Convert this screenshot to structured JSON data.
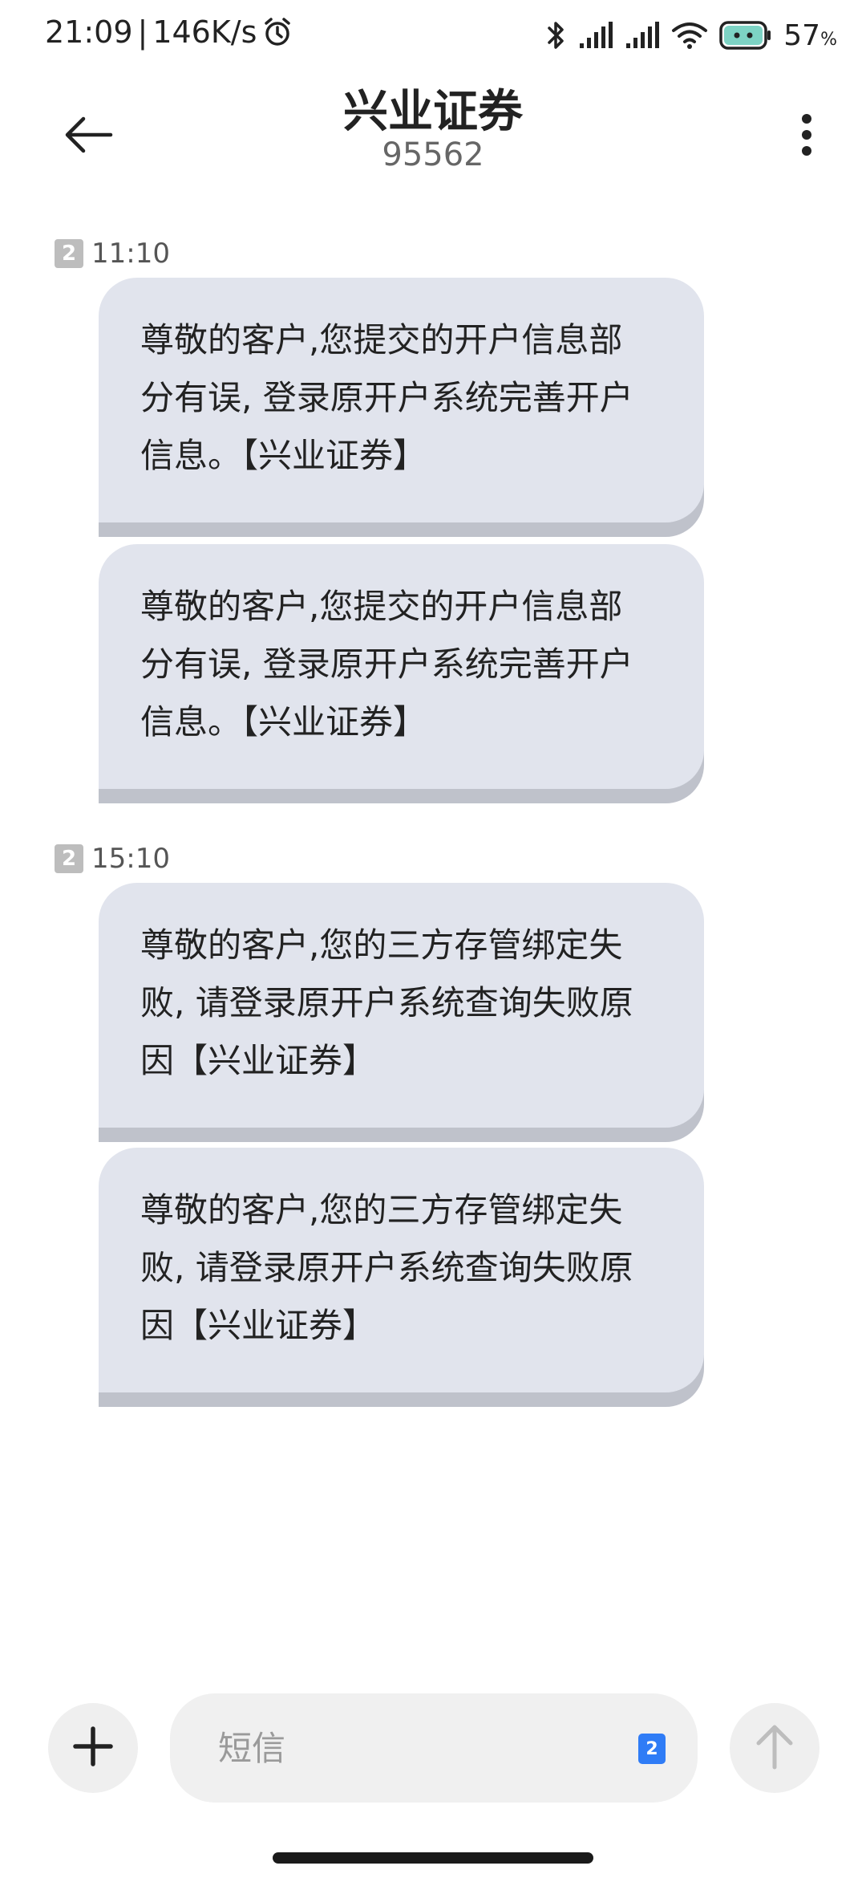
{
  "status_bar": {
    "time": "21:09",
    "separator": "|",
    "network_speed": "146K/s",
    "battery_percent": "57",
    "battery_unit": "%"
  },
  "header": {
    "title": "兴业证券",
    "subtitle": "95562"
  },
  "messages": [
    {
      "sim": "2",
      "time": "11:10",
      "bubbles": [
        {
          "lines": [
            "尊敬的客户,您提交的开户信息部",
            "分有误, 登录原开户系统完善开户",
            "信息。【兴业证券】"
          ]
        },
        {
          "lines": [
            "尊敬的客户,您提交的开户信息部",
            "分有误, 登录原开户系统完善开户",
            "信息。【兴业证券】"
          ]
        }
      ]
    },
    {
      "sim": "2",
      "time": "15:10",
      "bubbles": [
        {
          "lines": [
            "尊敬的客户,您的三方存管绑定失",
            "败, 请登录原开户系统查询失败原",
            "因【兴业证券】"
          ]
        },
        {
          "lines": [
            "尊敬的客户,您的三方存管绑定失",
            "败, 请登录原开户系统查询失败原",
            "因【兴业证券】"
          ]
        }
      ]
    }
  ],
  "input_bar": {
    "placeholder": "短信",
    "sim_selector": "2"
  },
  "colors": {
    "bubble_bg": "#e1e4ed",
    "bubble_shadow": "#bfc2cb",
    "sim_selector": "#2f7cf6",
    "sim_badge": "#bdbdbd"
  }
}
